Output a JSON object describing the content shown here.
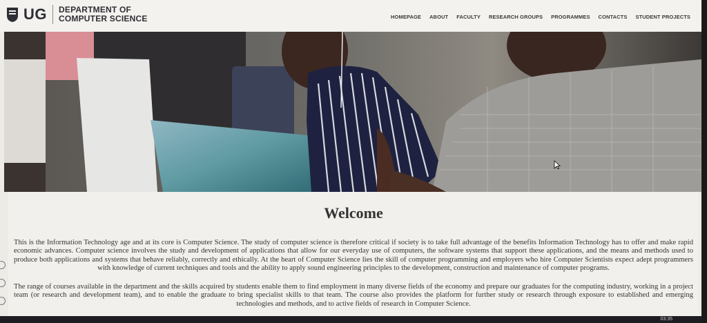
{
  "header": {
    "logo_abbr": "UG",
    "logo_line1": "DEPARTMENT OF",
    "logo_line2": "COMPUTER SCIENCE"
  },
  "nav": {
    "items": [
      "HOMEPAGE",
      "ABOUT",
      "FACULTY",
      "RESEARCH GROUPS",
      "PROGRAMMES",
      "CONTACTS",
      "STUDENT PROJECTS"
    ]
  },
  "main": {
    "title": "Welcome",
    "paragraph1": "This is the Information Technology age and at its core is Computer Science. The study of computer science is therefore critical if society is to take full advantage of the benefits Information Technology has to offer and make rapid economic advances. Computer science involves the study and development of applications that allow for our everyday use of computers, the software systems that support these applications, and the means and methods used to produce both applications and systems that behave reliably, correctly and ethically. At the heart of Computer Science lies the skill of computer programming and employers who hire Computer Scientists expect adept programmers with knowledge of current techniques and tools and the ability to apply sound engineering principles to the development, construction and maintenance of computer programs.",
    "paragraph2": "The range of courses available in the department and the skills acquired by students enable them to find employment in many diverse fields of the economy and prepare our graduates for the computing industry, working in a project team (or research and development team), and to enable the graduate to bring specialist skills to that team. The course also provides the platform for further study or research through exposure to established and emerging technologies and methods, and to active fields of research in Computer Science."
  },
  "taskbar": {
    "clock": "03:35"
  },
  "colors": {
    "header_bg": "#f3f2ee",
    "text": "#333333",
    "brand": "#2e2e35"
  }
}
